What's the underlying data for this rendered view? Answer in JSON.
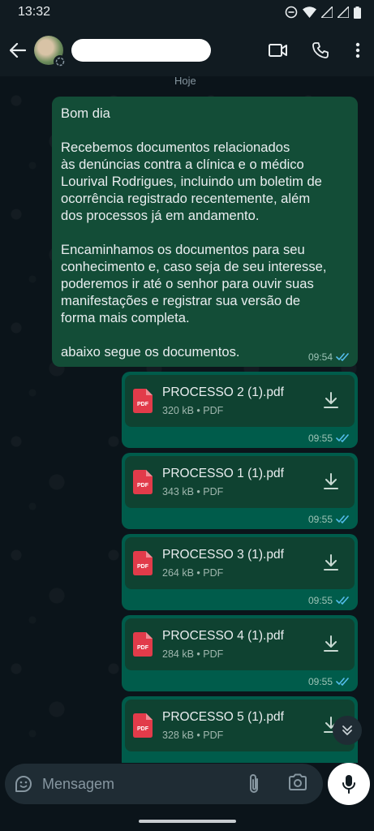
{
  "status": {
    "time": "13:32"
  },
  "header": {
    "contact_name_redacted": true
  },
  "chat": {
    "date_label": "Hoje",
    "first_message": {
      "text": "Bom dia\n\nRecebemos documentos relacionados\nàs denúncias contra a clínica e o médico\nLourival Rodrigues, incluindo um boletim de\nocorrência registrado recentemente, além\ndos processos já em andamento.\n\nEncaminhamos os documentos para seu\nconhecimento e, caso seja de seu interesse,\npoderemos ir até o senhor para ouvir suas\nmanifestações e registrar sua versão de\nforma mais completa.\n\nabaixo segue os documentos.",
      "time": "09:54"
    },
    "documents": [
      {
        "name": "PROCESSO 2 (1).pdf",
        "size": "320 kB",
        "type": "PDF",
        "time": "09:55"
      },
      {
        "name": "PROCESSO 1 (1).pdf",
        "size": "343 kB",
        "type": "PDF",
        "time": "09:55"
      },
      {
        "name": "PROCESSO 3 (1).pdf",
        "size": "264 kB",
        "type": "PDF",
        "time": "09:55"
      },
      {
        "name": "PROCESSO 4 (1).pdf",
        "size": "284 kB",
        "type": "PDF",
        "time": "09:55"
      },
      {
        "name": "PROCESSO 5 (1).pdf",
        "size": "328 kB",
        "type": "PDF",
        "time": ""
      }
    ]
  },
  "composer": {
    "placeholder": "Mensagem"
  },
  "colors": {
    "bubble_outgoing": "#005c4b",
    "read_ticks": "#53bdeb",
    "pdf_red": "#e23b4a",
    "background": "#0b141a"
  }
}
